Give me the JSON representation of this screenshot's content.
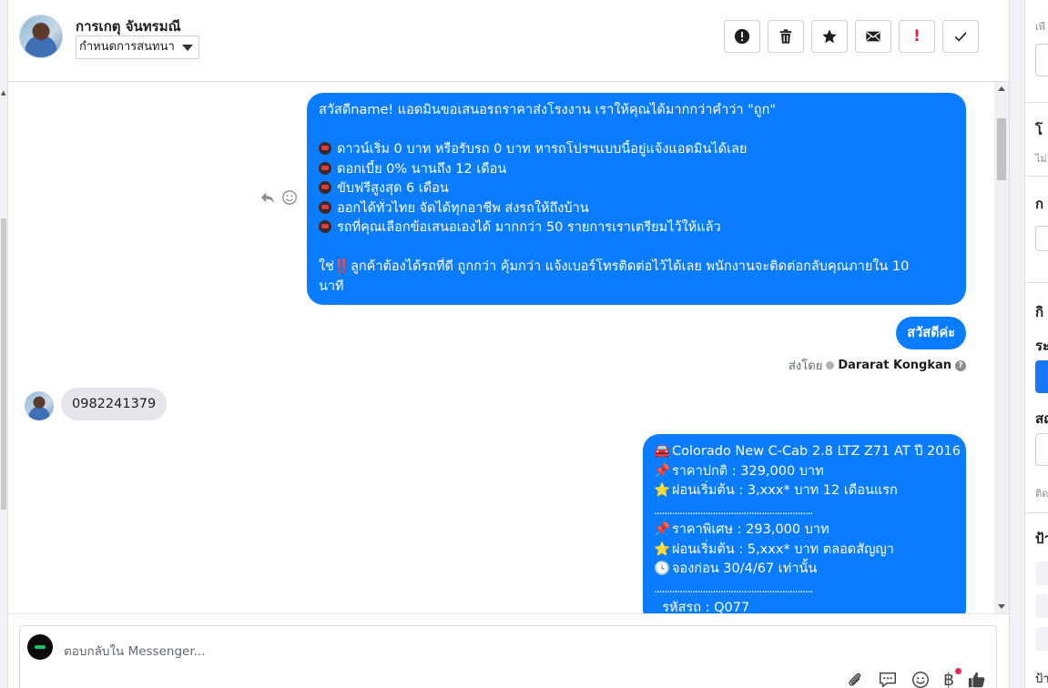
{
  "header": {
    "contact_name": "การเกตุ จันทรมณี",
    "conversation_select": "กำหนดการสนทนา",
    "actions": [
      {
        "name": "spam-button",
        "icon": "alert-circle-icon"
      },
      {
        "name": "delete-button",
        "icon": "trash-icon"
      },
      {
        "name": "star-button",
        "icon": "star-icon"
      },
      {
        "name": "mark-unread-button",
        "icon": "envelope-icon"
      },
      {
        "name": "follow-up-button",
        "icon": "exclamation-icon",
        "label": "!"
      },
      {
        "name": "mark-done-button",
        "icon": "check-icon"
      }
    ]
  },
  "messages": {
    "promo": {
      "greeting": "สวัสดีname! แอดมินขอเสนอรถราคาส่งโรงงาน เราให้คุณได้มากกว่าคำว่า \"ถูก\"",
      "points": [
        "ดาวน์เริ่ม 0 บาท หรือรับรถ 0 บาท หารถโปรฯแบบนี้อยู่แจ้งแอดมินได้เลย",
        "ดอกเบี้ย 0% นานถึง 12 เดือน",
        "ขับฟรีสูงสุด 6 เดือน",
        "ออกได้ทั่วไทย จัดได้ทุกอาชีพ ส่งรถให้ถึงบ้าน",
        "รถที่คุณเลือกข้อเสนอเองได้ มากกว่า 50 รายการเราเตรียมไว้ให้แล้ว"
      ],
      "closing_prefix": "ใช่",
      "closing_bang": "‼️",
      "closing_line1": "ลูกค้าต้องได้รถที่ดี ถูกกว่า คุ้มกว่า แจ้งเบอร์โทรติดต่อไว้ได้เลย พนักงานจะติดต่อกลับคุณภายใน 10",
      "closing_line2": "นาที"
    },
    "greeting_reply": "สวัสดีค่ะ",
    "sent_by_label": "ส่งโดย",
    "sent_by_name": "Dararat Kongkan",
    "customer_phone": "0982241379",
    "offer": {
      "title": "Colorado New C-Cab 2.8 LTZ Z71 AT ปี 2016",
      "normal_price": "ราคาปกติ : 329,000 บาท",
      "installment_1": "ผ่อนเริ่มต้น : 3,xxx* บาท 12 เดือนแรก",
      "divider": "..............................................................",
      "special_price": "ราคาพิเศษ : 293,000 บาท",
      "installment_2": "ผ่อนเริ่มต้น : 5,xxx* บาท ตลอดสัญญา",
      "booking": "จองก่อน 30/4/67 เท่านั้น",
      "divider2": "..............................................................",
      "code": "รหัสรถ : Q077"
    }
  },
  "composer": {
    "placeholder": "ตอบกลับใน Messenger...",
    "baht_symbol": "฿"
  },
  "right_panel": {
    "items": [
      "โ",
      "ไม่",
      "ก",
      "กิ",
      "ระ",
      "สถ",
      "ติด",
      "ป้า",
      "ป้า"
    ],
    "top_label": "เพื"
  },
  "colors": {
    "bubble_out": "#0a7cff",
    "bubble_in": "#e4e6eb",
    "accent": "#1877f2",
    "alert_red": "#e41e3f"
  }
}
